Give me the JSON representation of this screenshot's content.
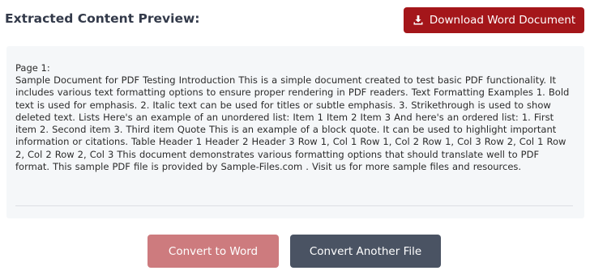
{
  "header": {
    "title": "Extracted Content Preview:",
    "download_label": "Download Word Document",
    "download_icon": "download-icon"
  },
  "preview": {
    "page_label": "Page 1:",
    "text": "Sample Document for PDF Testing  Introduction  This is a simple document created to test basic PDF functionality. It includes various text formatting  options to ensure proper rendering in PDF readers.  Text Formatting Examples  1. Bold text   is used for emphasis.  2.   Italic text   can be used for titles or subtle emphasis.  3.   Strikethrough   is used to show deleted text.  Lists  Here's an example of an unordered list:  Item 1  Item 2  Item 3  And here's an ordered list: 1.   First item  2.   Second item  3.   Third item  Quote  This is an example of a block quote. It can be used to highlight important information or  citations.  Table  Header 1   Header 2   Header 3  Row 1, Col 1   Row 1, Col 2   Row 1, Col 3 Row 2, Col 1   Row 2, Col 2   Row 2, Col 3  This document demonstrates various formatting options that should translate well to PDF format.  This sample PDF file is provided by   Sample-Files.com . Visit us for more sample files and resources."
  },
  "actions": {
    "convert_word_label": "Convert to Word",
    "convert_another_label": "Convert Another File"
  },
  "colors": {
    "download_button": "#a4161a",
    "convert_word_button": "#cd7b7e",
    "convert_another_button": "#4a5363",
    "preview_background": "#f5f7f9"
  }
}
